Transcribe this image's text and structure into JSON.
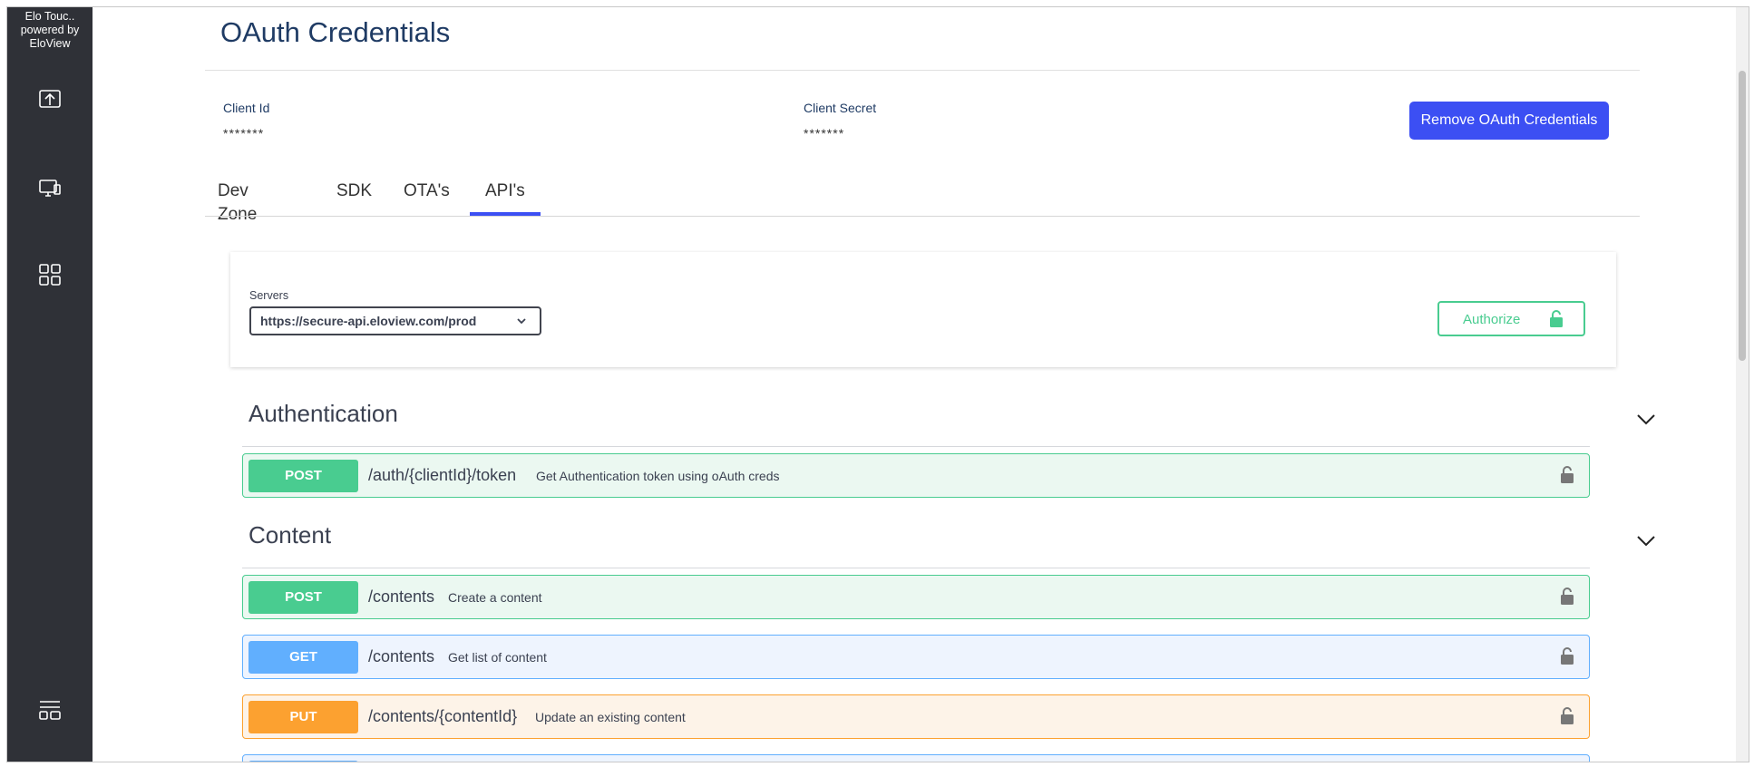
{
  "sidebar": {
    "brand_line1": "Elo Touc..",
    "brand_line2": "powered by",
    "brand_line3": "EloView",
    "icons": [
      "upload-icon",
      "devices-icon",
      "apps-grid-icon",
      "settings-list-icon"
    ]
  },
  "header": {
    "title": "OAuth Credentials"
  },
  "credentials": {
    "client_id_label": "Client Id",
    "client_id_value": "*******",
    "client_secret_label": "Client Secret",
    "client_secret_value": "*******",
    "remove_label": "Remove OAuth Credentials"
  },
  "tabs": [
    {
      "label": "Dev Zone",
      "active": false
    },
    {
      "label": "SDK",
      "active": false
    },
    {
      "label": "OTA's",
      "active": false
    },
    {
      "label": "API's",
      "active": true
    }
  ],
  "servers": {
    "label": "Servers",
    "selected": "https://secure-api.eloview.com/prod",
    "authorize_label": "Authorize"
  },
  "sections": [
    {
      "title": "Authentication",
      "operations": [
        {
          "method": "POST",
          "path": "/auth/{clientId}/token",
          "description": "Get Authentication token using oAuth creds"
        }
      ]
    },
    {
      "title": "Content",
      "operations": [
        {
          "method": "POST",
          "path": "/contents",
          "description": "Create a content"
        },
        {
          "method": "GET",
          "path": "/contents",
          "description": "Get list of content"
        },
        {
          "method": "PUT",
          "path": "/contents/{contentId}",
          "description": "Update an existing content"
        }
      ]
    }
  ],
  "colors": {
    "sidebar_bg": "#2f3137",
    "accent": "#3c4ff3",
    "post": "#49cc90",
    "get": "#61affe",
    "put": "#fca130"
  }
}
